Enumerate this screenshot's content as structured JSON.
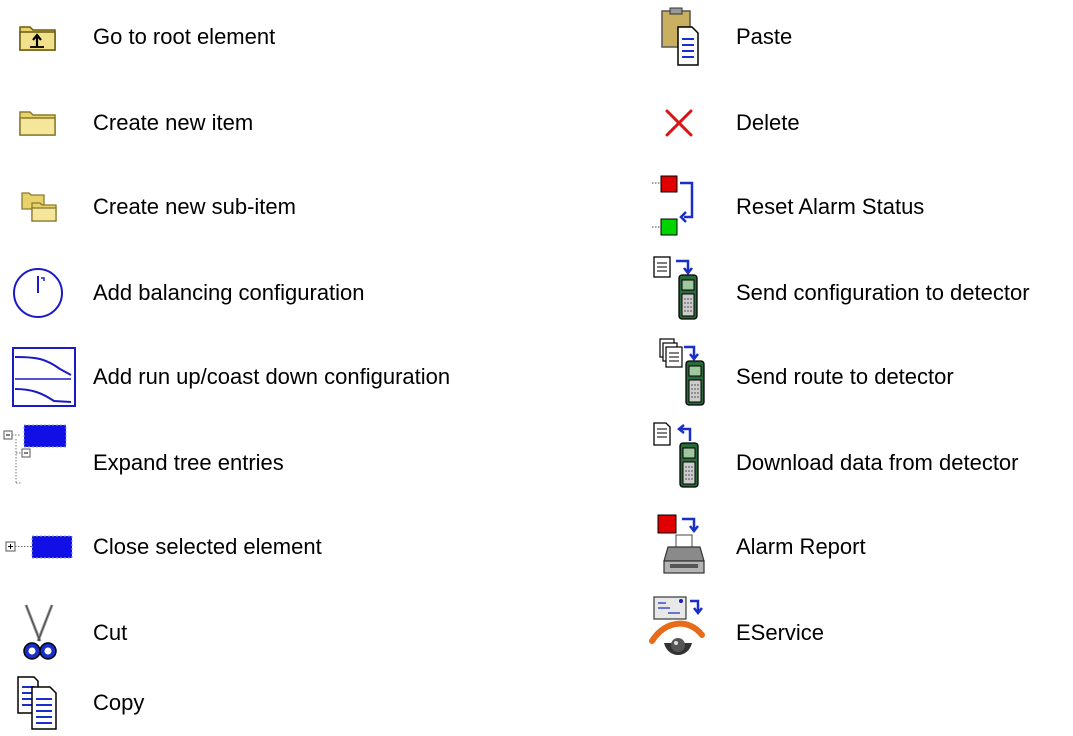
{
  "legend": {
    "left": [
      {
        "icon": "folder-up-icon",
        "label": "Go to root element"
      },
      {
        "icon": "folder-icon",
        "label": "Create new item"
      },
      {
        "icon": "folders-icon",
        "label": "Create new sub-item"
      },
      {
        "icon": "clock-icon",
        "label": "Add balancing configuration"
      },
      {
        "icon": "curve-chart-icon",
        "label": "Add run up/coast down configuration"
      },
      {
        "icon": "tree-expand-icon",
        "label": "Expand tree entries"
      },
      {
        "icon": "tree-collapse-icon",
        "label": "Close selected element"
      },
      {
        "icon": "scissors-icon",
        "label": "Cut"
      },
      {
        "icon": "copy-icon",
        "label": "Copy"
      }
    ],
    "right": [
      {
        "icon": "paste-icon",
        "label": "Paste"
      },
      {
        "icon": "delete-x-icon",
        "label": "Delete"
      },
      {
        "icon": "reset-alarm-icon",
        "label": "Reset Alarm Status"
      },
      {
        "icon": "send-config-icon",
        "label": "Send configuration to detector"
      },
      {
        "icon": "send-route-icon",
        "label": "Send route to detector"
      },
      {
        "icon": "download-data-icon",
        "label": "Download data from detector"
      },
      {
        "icon": "alarm-report-printer-icon",
        "label": "Alarm Report"
      },
      {
        "icon": "eservice-icon",
        "label": "EService"
      }
    ]
  }
}
